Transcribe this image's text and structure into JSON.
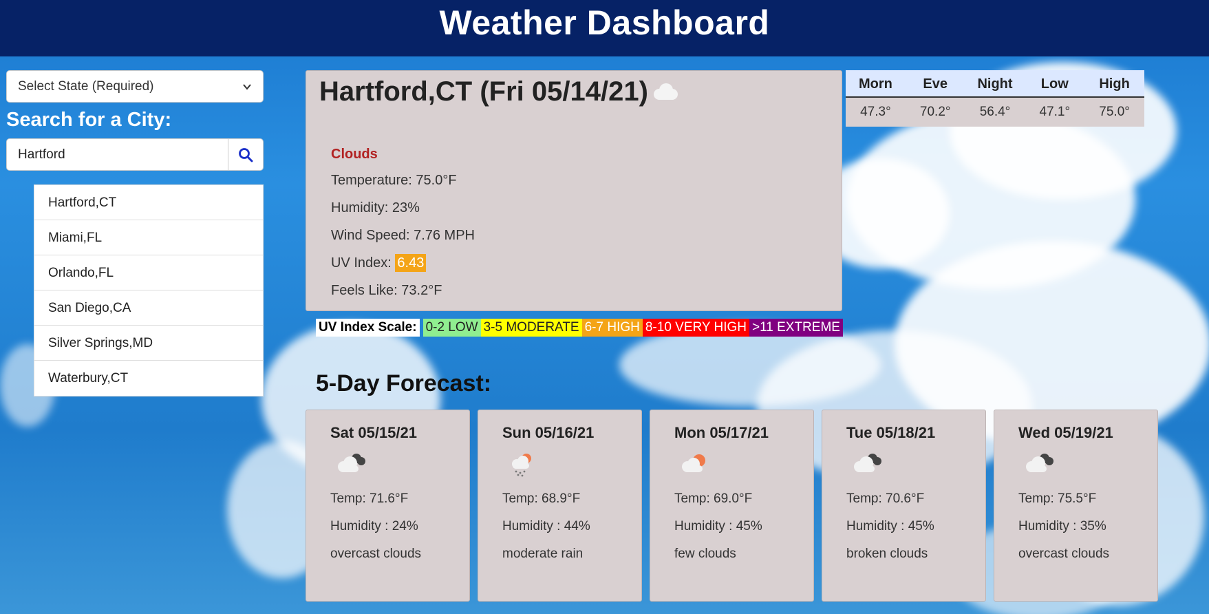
{
  "header": {
    "title": "Weather Dashboard"
  },
  "sidebar": {
    "state_select": "Select State (Required)",
    "search_label": "Search for a City:",
    "search_value": "Hartford",
    "cities": [
      "Hartford,CT",
      "Miami,FL",
      "Orlando,FL",
      "San Diego,CA",
      "Silver Springs,MD",
      "Waterbury,CT"
    ]
  },
  "current": {
    "title": "Hartford,CT (Fri 05/14/21)",
    "icon": "cloud-icon",
    "description": "Clouds",
    "temperature": "Temperature: 75.0°F",
    "humidity": "Humidity: 23%",
    "wind": "Wind Speed: 7.76 MPH",
    "uv_label": "UV Index: ",
    "uv_value": "6.43",
    "feels_like": "Feels Like: 73.2°F"
  },
  "temps": {
    "headers": [
      "Morn",
      "Eve",
      "Night",
      "Low",
      "High"
    ],
    "values": [
      "47.3°",
      "70.2°",
      "56.4°",
      "47.1°",
      "75.0°"
    ]
  },
  "uv_scale": {
    "label": "UV Index Scale:",
    "levels": [
      {
        "text": "0-2 LOW",
        "bg": "#90ee90",
        "color": "#222222"
      },
      {
        "text": "3-5 MODERATE",
        "bg": "#ffff00",
        "color": "#222222"
      },
      {
        "text": "6-7 HIGH",
        "bg": "#f4a417",
        "color": "#ffffff"
      },
      {
        "text": "8-10 VERY HIGH",
        "bg": "#ff0000",
        "color": "#ffffff"
      },
      {
        "text": ">11 EXTREME",
        "bg": "#800080",
        "color": "#ffffff"
      }
    ]
  },
  "forecast_title": "5-Day Forecast:",
  "forecast": [
    {
      "date": "Sat 05/15/21",
      "icon": "overcast-clouds-icon",
      "temp": "Temp: 71.6°F",
      "humidity": "Humidity : 24%",
      "desc": "overcast clouds"
    },
    {
      "date": "Sun 05/16/21",
      "icon": "rain-icon",
      "temp": "Temp: 68.9°F",
      "humidity": "Humidity : 44%",
      "desc": "moderate rain"
    },
    {
      "date": "Mon 05/17/21",
      "icon": "few-clouds-icon",
      "temp": "Temp: 69.0°F",
      "humidity": "Humidity : 45%",
      "desc": "few clouds"
    },
    {
      "date": "Tue 05/18/21",
      "icon": "broken-clouds-icon",
      "temp": "Temp: 70.6°F",
      "humidity": "Humidity : 45%",
      "desc": "broken clouds"
    },
    {
      "date": "Wed 05/19/21",
      "icon": "overcast-clouds-icon",
      "temp": "Temp: 75.5°F",
      "humidity": "Humidity : 35%",
      "desc": "overcast clouds"
    }
  ],
  "colors": {
    "header_bg": "#062266",
    "card_bg": "#d9d0d1",
    "description_red": "#b22222",
    "uv_badge": "#f4a417"
  }
}
